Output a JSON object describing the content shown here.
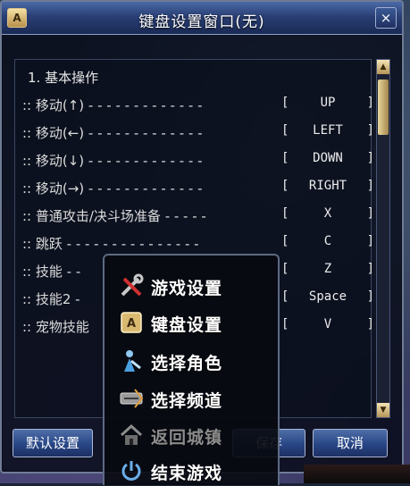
{
  "window": {
    "title": "键盘设置窗口(无)",
    "title_icon": "A",
    "close_label": "×"
  },
  "section": {
    "label": "1. 基本操作"
  },
  "bindings": [
    {
      "label": "::  移动(↑)  - - - - - - - - - - - - -",
      "key": "UP"
    },
    {
      "label": "::  移动(←)  - - - - - - - - - - - - -",
      "key": "LEFT"
    },
    {
      "label": "::  移动(↓)  - - - - - - - - - - - - -",
      "key": "DOWN"
    },
    {
      "label": "::  移动(→)  - - - - - - - - - - - - -",
      "key": "RIGHT"
    },
    {
      "label": "::  普通攻击/决斗场准备 - - - - -",
      "key": "X"
    },
    {
      "label": "::  跳跃  - - - - - - - - - - - - - - -",
      "key": "C"
    },
    {
      "label": "::  技能  - -",
      "key": "Z"
    },
    {
      "label": "::  技能2 -",
      "key": "Space"
    },
    {
      "label": "::  宠物技能",
      "key": "V"
    }
  ],
  "brackets": {
    "left": "[",
    "right": "]"
  },
  "scrollbar": {
    "up": "▲",
    "down": "▼"
  },
  "buttons": {
    "default": "默认设置",
    "save": "保存",
    "cancel": "取消"
  },
  "menu": {
    "items": [
      {
        "label": "游戏设置",
        "icon": "tools-icon",
        "disabled": false
      },
      {
        "label": "键盘设置",
        "icon": "keyboard-icon",
        "disabled": false
      },
      {
        "label": "选择角色",
        "icon": "character-icon",
        "disabled": false
      },
      {
        "label": "选择频道",
        "icon": "channel-icon",
        "disabled": false
      },
      {
        "label": "返回城镇",
        "icon": "home-icon",
        "disabled": true
      },
      {
        "label": "结束游戏",
        "icon": "power-icon",
        "disabled": false
      }
    ]
  },
  "colors": {
    "title_bar": "#2a3f75",
    "button": "#284685",
    "menu_bg": "#08090f",
    "disabled_text": "#8c8c8c"
  }
}
